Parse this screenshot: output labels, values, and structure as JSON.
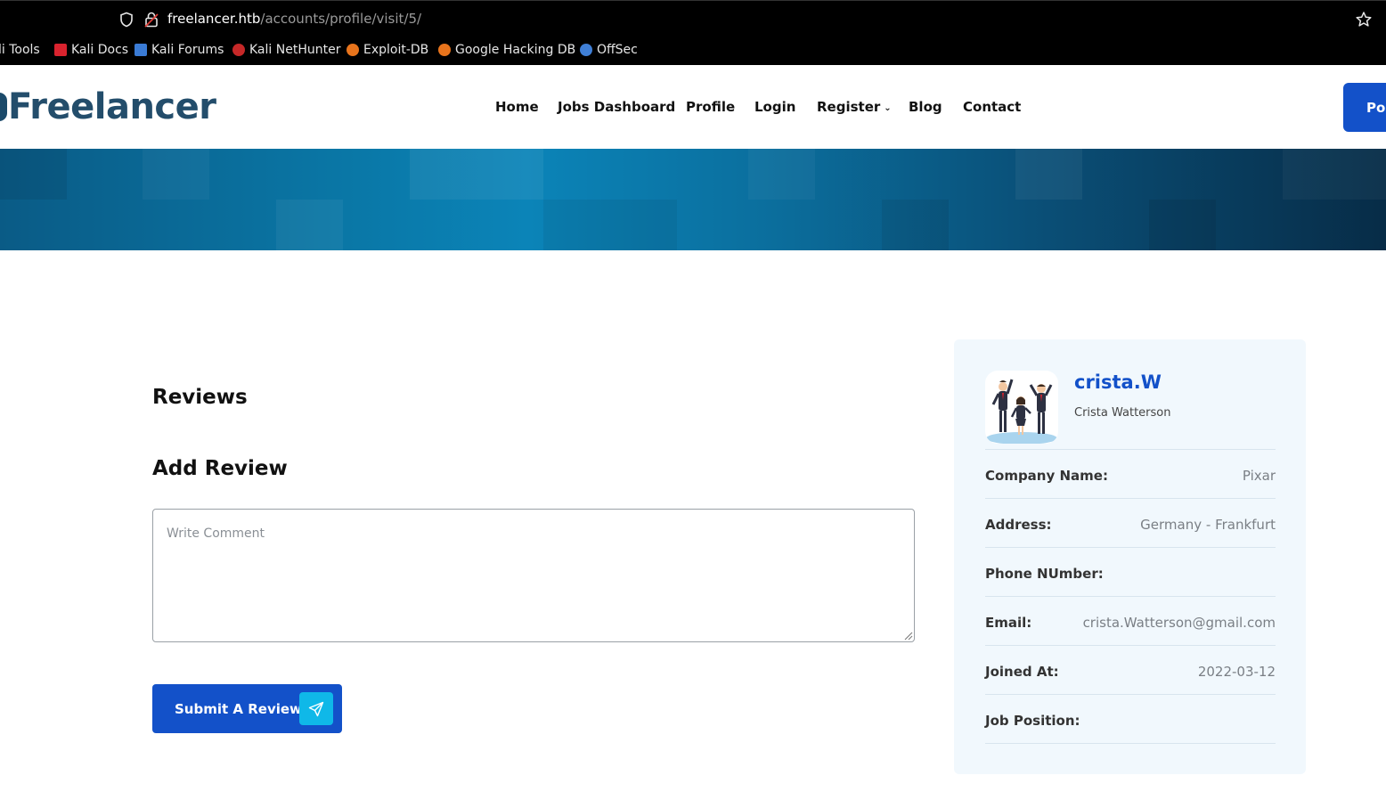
{
  "browser": {
    "url_host": "freelancer.htb",
    "url_path": "/accounts/profile/visit/5/",
    "bookmarks": [
      {
        "label": "li Tools",
        "icon": "kali-icon"
      },
      {
        "label": "Kali Docs",
        "icon": "kali-docs-icon",
        "color": "#d9232e"
      },
      {
        "label": "Kali Forums",
        "icon": "kali-forums-icon",
        "color": "#3a7bd5"
      },
      {
        "label": "Kali NetHunter",
        "icon": "nethunter-icon",
        "color": "#c62828"
      },
      {
        "label": "Exploit-DB",
        "icon": "exploitdb-icon",
        "color": "#e8741c"
      },
      {
        "label": "Google Hacking DB",
        "icon": "ghdb-icon",
        "color": "#e8741c"
      },
      {
        "label": "OffSec",
        "icon": "offsec-icon",
        "color": "#3f7fd6"
      }
    ]
  },
  "header": {
    "logo": "Freelancer",
    "nav": [
      {
        "label": "Home"
      },
      {
        "label": "Jobs Dashboard"
      },
      {
        "label": "Profile"
      },
      {
        "label": "Login"
      },
      {
        "label": "Register",
        "has_dropdown": true
      },
      {
        "label": "Blog"
      },
      {
        "label": "Contact"
      }
    ],
    "post_button": "Pos"
  },
  "main": {
    "reviews_title": "Reviews",
    "add_review_title": "Add Review",
    "comment_placeholder": "Write Comment",
    "submit_label": "Submit A Review"
  },
  "profile": {
    "username": "crista.W",
    "full_name": "Crista Watterson",
    "fields": [
      {
        "label": "Company Name:",
        "value": "Pixar"
      },
      {
        "label": "Address:",
        "value": "Germany - Frankfurt"
      },
      {
        "label": "Phone NUmber:",
        "value": ""
      },
      {
        "label": "Email:",
        "value": "crista.Watterson@gmail.com"
      },
      {
        "label": "Joined At:",
        "value": "2022-03-12"
      },
      {
        "label": "Job Position:",
        "value": ""
      }
    ]
  },
  "colors": {
    "primary": "#1351c9",
    "accent": "#0fb8e8",
    "card_bg": "#f1f8fd",
    "logo": "#234d6b"
  }
}
